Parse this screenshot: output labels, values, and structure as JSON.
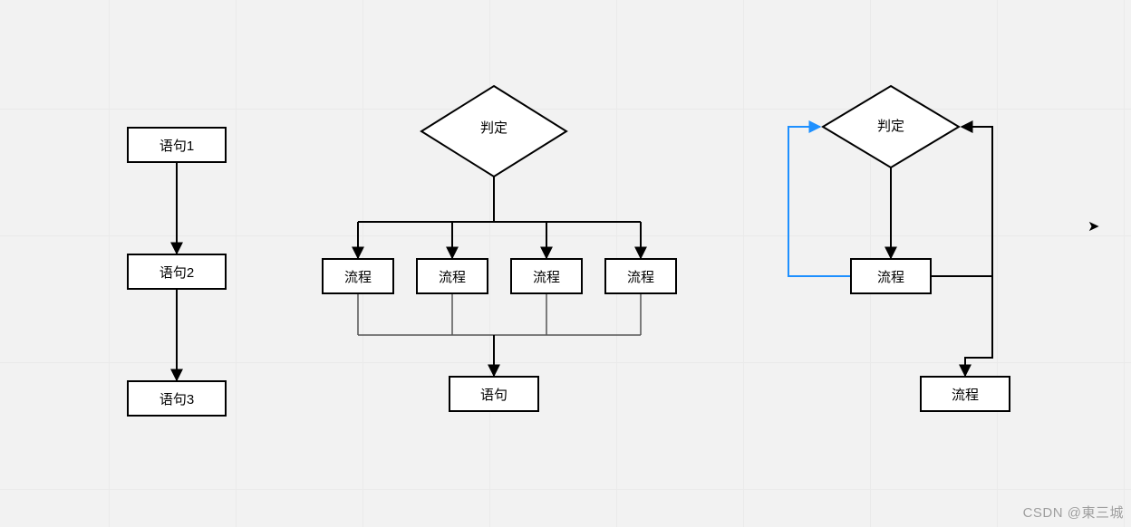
{
  "chart_data": {
    "type": "flowchart",
    "left_sequence": {
      "nodes": [
        {
          "id": "s1",
          "shape": "rect",
          "label": "语句1"
        },
        {
          "id": "s2",
          "shape": "rect",
          "label": "语句2"
        },
        {
          "id": "s3",
          "shape": "rect",
          "label": "语句3"
        }
      ],
      "edges": [
        {
          "from": "s1",
          "to": "s2"
        },
        {
          "from": "s2",
          "to": "s3"
        }
      ]
    },
    "center_decision": {
      "nodes": [
        {
          "id": "d",
          "shape": "diamond",
          "label": "判定"
        },
        {
          "id": "p1",
          "shape": "rect",
          "label": "流程"
        },
        {
          "id": "p2",
          "shape": "rect",
          "label": "流程"
        },
        {
          "id": "p3",
          "shape": "rect",
          "label": "流程"
        },
        {
          "id": "p4",
          "shape": "rect",
          "label": "流程"
        },
        {
          "id": "st",
          "shape": "rect",
          "label": "语句"
        }
      ],
      "edges": [
        {
          "from": "d",
          "to": "p1"
        },
        {
          "from": "d",
          "to": "p2"
        },
        {
          "from": "d",
          "to": "p3"
        },
        {
          "from": "d",
          "to": "p4"
        },
        {
          "from": "p1",
          "to": "st"
        },
        {
          "from": "p2",
          "to": "st"
        },
        {
          "from": "p3",
          "to": "st"
        },
        {
          "from": "p4",
          "to": "st"
        }
      ]
    },
    "right_loop": {
      "nodes": [
        {
          "id": "rd",
          "shape": "diamond",
          "label": "判定"
        },
        {
          "id": "rp",
          "shape": "rect",
          "label": "流程"
        },
        {
          "id": "re",
          "shape": "rect",
          "label": "流程"
        }
      ],
      "edges": [
        {
          "from": "rd",
          "to": "rp"
        },
        {
          "from": "rp",
          "to": "rd",
          "loop_back": true,
          "color": "#1e90ff"
        },
        {
          "from": "rd",
          "to": "re",
          "via": "right",
          "loop_back": true
        }
      ]
    }
  },
  "watermark": "CSDN @東三城"
}
